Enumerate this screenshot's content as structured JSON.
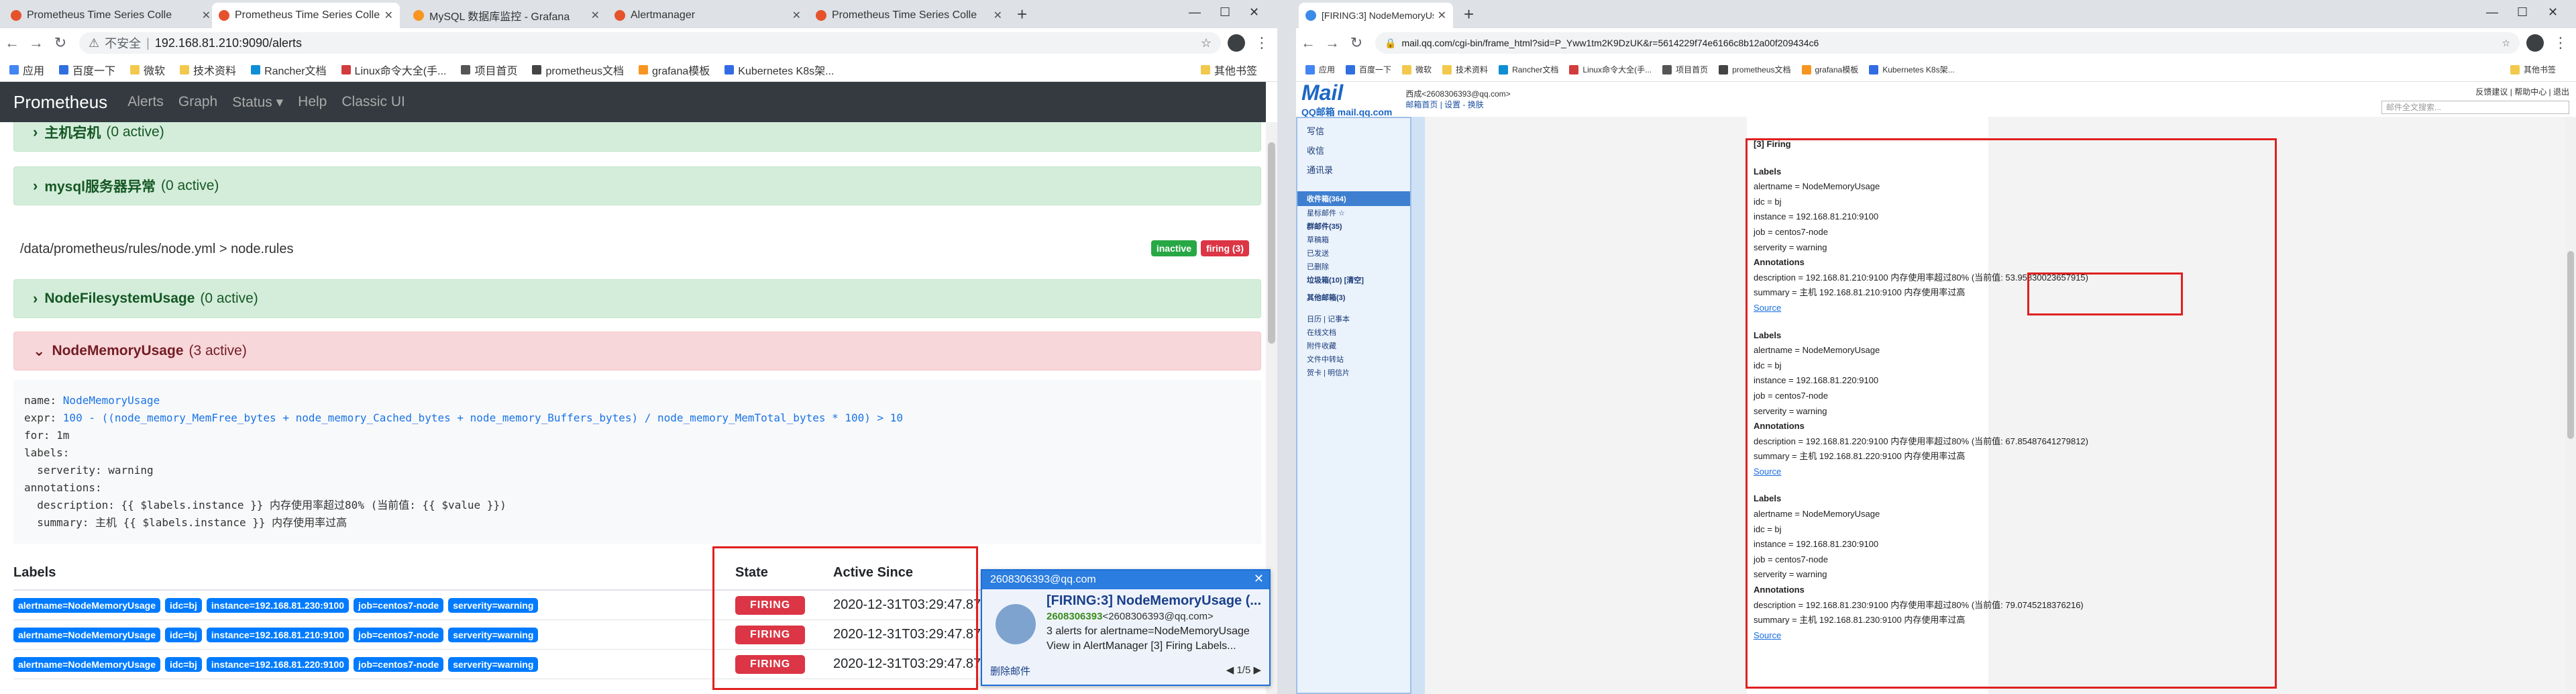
{
  "left_browser": {
    "tabs": [
      {
        "title": "Prometheus Time Series Colle",
        "fav": "#e6522c"
      },
      {
        "title": "Prometheus Time Series Colle",
        "fav": "#e6522c"
      },
      {
        "title": "MySQL 数据库监控 - Grafana",
        "fav": "#f79520"
      },
      {
        "title": "Alertmanager",
        "fav": "#e6522c"
      },
      {
        "title": "Prometheus Time Series Colle",
        "fav": "#e6522c"
      }
    ],
    "address": {
      "security": "不安全",
      "url": "192.168.81.210:9090/alerts"
    },
    "bookmarks": [
      "应用",
      "百度一下",
      "微软",
      "技术资料",
      "Rancher文档",
      "Linux命令大全(手...",
      "项目首页",
      "prometheus文档",
      "grafana模板",
      "Kubernetes K8s架..."
    ],
    "bookmarks_other": "其他书签"
  },
  "prometheus": {
    "brand": "Prometheus",
    "nav": [
      "Alerts",
      "Graph",
      "Status ▾",
      "Help",
      "Classic UI"
    ],
    "groups": [
      {
        "name": "主机宕机",
        "count": "(0 active)"
      },
      {
        "name": "mysql服务器异常",
        "count": "(0 active)"
      },
      {
        "name": "NodeFilesystemUsage",
        "count": "(0 active)"
      },
      {
        "name": "NodeMemoryUsage",
        "count": "(3 active)"
      }
    ],
    "rule_file": "/data/prometheus/rules/node.yml > node.rules",
    "badge_inactive": "inactive",
    "badge_firing": "firing (3)",
    "rule_yaml": {
      "name_key": "name: ",
      "name_val": "NodeMemoryUsage",
      "expr_key": "expr: ",
      "expr_val": "100 - ((node_memory_MemFree_bytes + node_memory_Cached_bytes + node_memory_Buffers_bytes) / node_memory_MemTotal_bytes * 100) > 10",
      "rest": "for: 1m\nlabels:\n  serverity: warning\nannotations:\n  description: {{ $labels.instance }} 内存使用率超过80% (当前值: {{ $value }})\n  summary: 主机 {{ $labels.instance }} 内存使用率过高"
    },
    "table": {
      "headers": {
        "labels": "Labels",
        "state": "State",
        "since": "Active Since"
      },
      "rows": [
        {
          "labels": [
            "alertname=NodeMemoryUsage",
            "idc=bj",
            "instance=192.168.81.230:9100",
            "job=centos7-node",
            "serverity=warning"
          ],
          "state": "FIRING",
          "since": "2020-12-31T03:29:47.874"
        },
        {
          "labels": [
            "alertname=NodeMemoryUsage",
            "idc=bj",
            "instance=192.168.81.210:9100",
            "job=centos7-node",
            "serverity=warning"
          ],
          "state": "FIRING",
          "since": "2020-12-31T03:29:47.874"
        },
        {
          "labels": [
            "alertname=NodeMemoryUsage",
            "idc=bj",
            "instance=192.168.81.220:9100",
            "job=centos7-node",
            "serverity=warning"
          ],
          "state": "FIRING",
          "since": "2020-12-31T03:29:47.874"
        }
      ]
    }
  },
  "toast": {
    "account": "2608306393@qq.com",
    "subject": "[FIRING:3] NodeMemoryUsage (...",
    "from_name": "2608306393",
    "from_addr": "<2608306393@qq.com>",
    "body": "3 alerts for alertname=NodeMemoryUsage View in AlertManager [3] Firing Labels...",
    "delete": "删除邮件",
    "pager": "1/5"
  },
  "right_browser": {
    "tab_title": "[FIRING:3] NodeMemoryUsag",
    "address": {
      "url": "mail.qq.com/cgi-bin/frame_html?sid=P_Yww1tm2K9DzUK&r=5614229f74e6166c8b12a00f209434c6"
    },
    "bookmarks": [
      "应用",
      "百度一下",
      "微软",
      "技术资料",
      "Rancher文档",
      "Linux命令大全(手...",
      "项目首页",
      "prometheus文档",
      "grafana模板",
      "Kubernetes K8s架..."
    ],
    "bookmarks_other": "其他书签"
  },
  "qqmail": {
    "logo": "Mail",
    "logo_sub": "QQ邮箱 mail.qq.com",
    "account_line": "西成<2608306393@qq.com>",
    "account_links": "邮箱首页 | 设置 - 换肤",
    "top_links": "反馈建议 | 帮助中心 | 退出",
    "search_placeholder": "邮件全文搜索...",
    "sidebar": [
      "写信",
      "收信",
      "通讯录"
    ],
    "folders": [
      "收件箱(364)",
      "星标邮件 ☆",
      "群邮件(35)",
      "草稿箱",
      "已发送",
      "已删除",
      "垃圾箱(10) [清空]",
      "其他邮箱(3)"
    ],
    "tools": [
      "日历 | 记事本",
      "在线文档",
      "附件收藏",
      "文件中转站",
      "贺卡 | 明信片"
    ],
    "mail": {
      "heading": "[3] Firing",
      "blocks": [
        {
          "labels_hd": "Labels",
          "lines": [
            "alertname = NodeMemoryUsage",
            "idc = bj",
            "instance = 192.168.81.210:9100",
            "job = centos7-node",
            "serverity = warning"
          ],
          "ann_hd": "Annotations",
          "desc": "description = 192.168.81.210:9100 内存使用率超过80% (当前值: 53.95830023657915)",
          "summary": "summary = 主机 192.168.81.210:9100 内存使用率过高",
          "source": "Source"
        },
        {
          "labels_hd": "Labels",
          "lines": [
            "alertname = NodeMemoryUsage",
            "idc = bj",
            "instance = 192.168.81.220:9100",
            "job = centos7-node",
            "serverity = warning"
          ],
          "ann_hd": "Annotations",
          "desc": "description = 192.168.81.220:9100 内存使用率超过80% (当前值: 67.85487641279812)",
          "summary": "summary = 主机 192.168.81.220:9100 内存使用率过高",
          "source": "Source"
        },
        {
          "labels_hd": "Labels",
          "lines": [
            "alertname = NodeMemoryUsage",
            "idc = bj",
            "instance = 192.168.81.230:9100",
            "job = centos7-node",
            "serverity = warning"
          ],
          "ann_hd": "Annotations",
          "desc": "description = 192.168.81.230:9100 内存使用率超过80% (当前值: 79.0745218376216)",
          "summary": "summary = 主机 192.168.81.230:9100 内存使用率过高",
          "source": "Source"
        }
      ]
    }
  },
  "colors": {
    "firing": "#dc3545",
    "inactive": "#28a745",
    "label": "#007bff",
    "highlight": "#e02020"
  }
}
